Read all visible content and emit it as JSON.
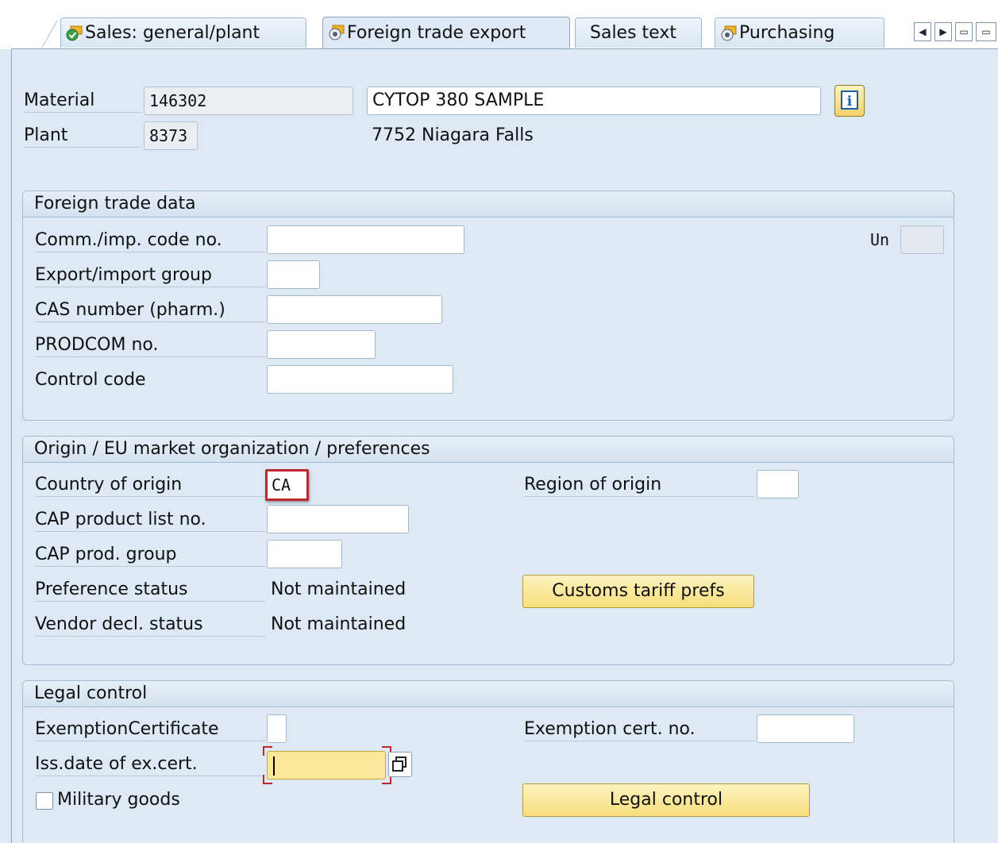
{
  "tabs": [
    {
      "label": "Sales: general/plant",
      "icon": "check-icon"
    },
    {
      "label": "Foreign trade export",
      "icon": "settings-icon"
    },
    {
      "label": "Sales text",
      "icon": ""
    },
    {
      "label": "Purchasing",
      "icon": "settings-icon"
    }
  ],
  "header": {
    "material_label": "Material",
    "material_value": "146302",
    "material_desc": "CYTOP 380 SAMPLE",
    "plant_label": "Plant",
    "plant_value": "8373",
    "plant_desc": "7752 Niagara Falls"
  },
  "foreign_trade": {
    "title": "Foreign trade data",
    "comm_label": "Comm./imp. code no.",
    "export_group_label": "Export/import group",
    "cas_label": "CAS number (pharm.)",
    "prodcom_label": "PRODCOM no.",
    "control_code_label": "Control code",
    "un_label": "Un"
  },
  "origin": {
    "title": "Origin / EU market organization / preferences",
    "country_label": "Country of origin",
    "country_value": "CA",
    "region_label": "Region of origin",
    "cap_list_label": "CAP product list no.",
    "cap_group_label": "CAP prod. group",
    "pref_status_label": "Preference status",
    "pref_status_value": "Not maintained",
    "vendor_decl_label": "Vendor decl. status",
    "vendor_decl_value": "Not maintained",
    "customs_button": "Customs tariff prefs"
  },
  "legal": {
    "title": "Legal control",
    "exemption_cert_label": "ExemptionCertificate",
    "exemption_no_label": "Exemption cert. no.",
    "iss_date_label": "Iss.date of ex.cert.",
    "military_label": "Military goods",
    "legal_button": "Legal control"
  },
  "colors": {
    "background": "#dde9f5",
    "button": "#f7dd7b",
    "highlight_border": "#c0262d",
    "required_field": "#fde89a"
  }
}
